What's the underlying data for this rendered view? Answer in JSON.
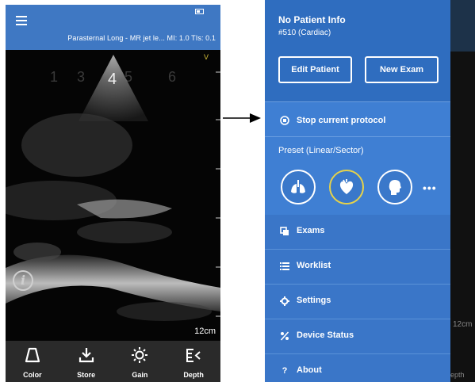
{
  "left_screen": {
    "header": {
      "scan_info": "Parasternal Long - MR jet le... MI: 1.0  TIs: 0.1"
    },
    "image": {
      "depth": "12cm",
      "orientation_marker": "V",
      "scan_sector_numbers": [
        "1",
        "3",
        "4",
        "5",
        "6"
      ]
    },
    "toolbar": {
      "items": [
        {
          "label": "Color",
          "icon": "color-icon"
        },
        {
          "label": "Store",
          "icon": "store-icon"
        },
        {
          "label": "Gain",
          "icon": "gain-icon"
        },
        {
          "label": "Depth",
          "icon": "depth-icon"
        }
      ]
    }
  },
  "right_screen": {
    "patient": {
      "name": "No Patient Info",
      "id": "#510 (Cardiac)"
    },
    "buttons": {
      "edit_patient": "Edit Patient",
      "new_exam": "New Exam"
    },
    "protocol": {
      "label": "Stop current protocol"
    },
    "preset": {
      "title": "Preset (Linear/Sector)",
      "options": [
        "lungs-icon",
        "heart-icon",
        "head-icon"
      ],
      "selected_index": 1,
      "more": "•••"
    },
    "menu": {
      "items": [
        {
          "label": "Exams",
          "icon": "exams-icon"
        },
        {
          "label": "Worklist",
          "icon": "worklist-icon"
        },
        {
          "label": "Settings",
          "icon": "settings-icon"
        },
        {
          "label": "Device Status",
          "icon": "device-status-icon"
        },
        {
          "label": "About",
          "icon": "about-icon",
          "glyph": "?"
        }
      ]
    },
    "background_peek": {
      "depth_fragment": "12cm",
      "label_fragment": "epth"
    }
  },
  "colors": {
    "header_blue": "#3f78c3",
    "drawer_blue": "#3f7fd3",
    "patient_block_blue": "#2f6dbf",
    "selected_ring": "#e6d24a",
    "toolbar_dark": "#2a2a2a"
  }
}
